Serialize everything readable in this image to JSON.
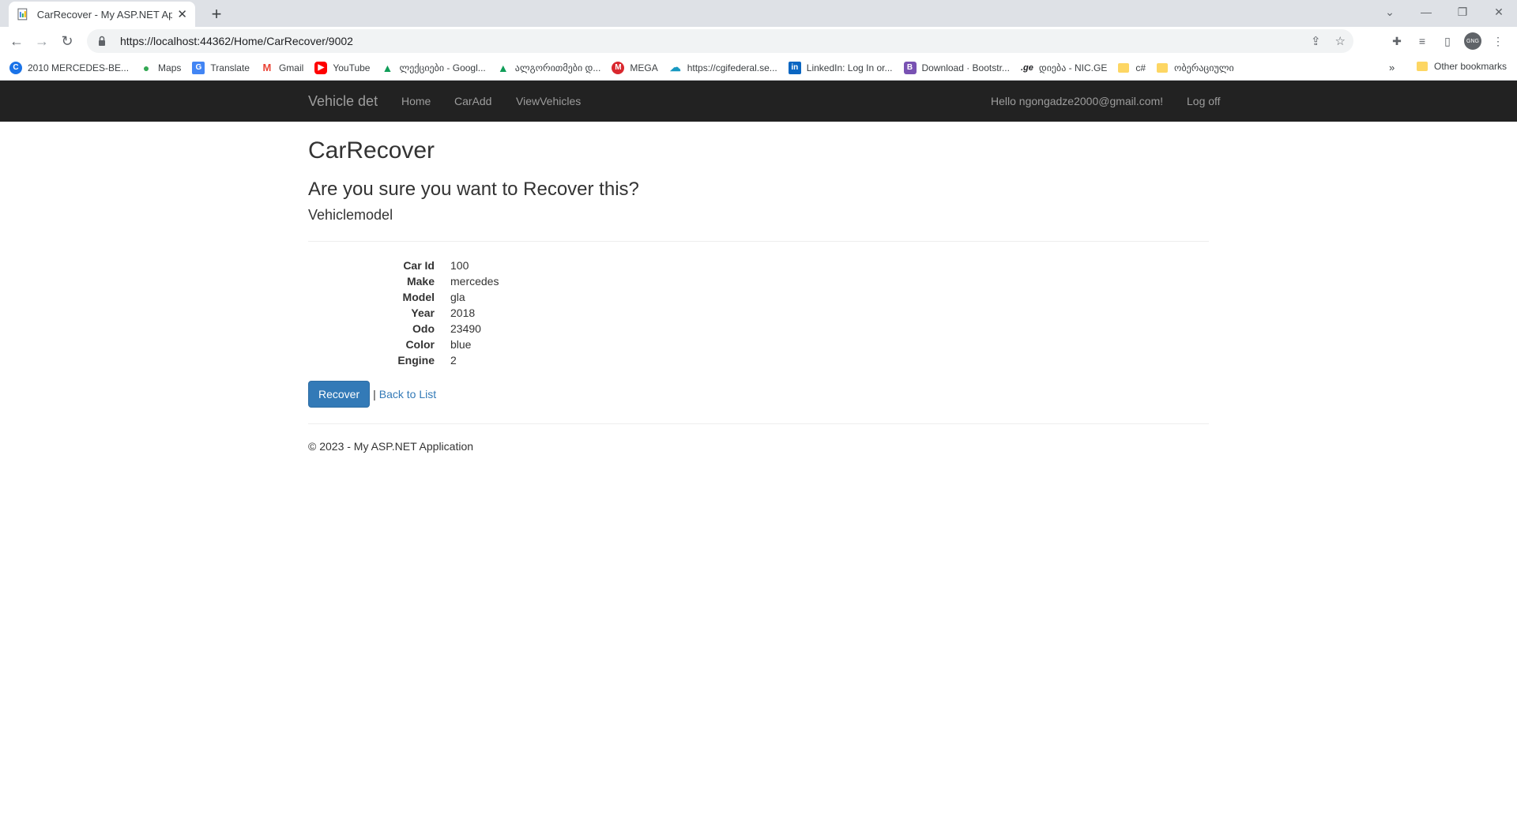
{
  "browser": {
    "tab_title": "CarRecover - My ASP.NET Applic",
    "tab_close": "✕",
    "new_tab": "+",
    "url": "https://localhost:44362/Home/CarRecover/9002",
    "profile_initials": "GNG",
    "bookmarks": [
      {
        "label": "2010 MERCEDES-BE...",
        "icon": "c-icon",
        "color": "#1a73e8"
      },
      {
        "label": "Maps",
        "icon": "maps-pin-icon",
        "color": "#34a853"
      },
      {
        "label": "Translate",
        "icon": "translate-icon",
        "color": "#4285f4"
      },
      {
        "label": "Gmail",
        "icon": "gmail-icon",
        "color": "#ea4335"
      },
      {
        "label": "YouTube",
        "icon": "youtube-icon",
        "color": "#ff0000"
      },
      {
        "label": "ლექციები - Googl...",
        "icon": "drive-icon",
        "color": "#fbbc04"
      },
      {
        "label": "ალგორითმები დ...",
        "icon": "drive-icon",
        "color": "#fbbc04"
      },
      {
        "label": "MEGA",
        "icon": "mega-icon",
        "color": "#d9272e"
      },
      {
        "label": "https://cgifederal.se...",
        "icon": "cloud-icon",
        "color": "#1798c1"
      },
      {
        "label": "LinkedIn: Log In or...",
        "icon": "linkedin-icon",
        "color": "#0a66c2"
      },
      {
        "label": "Download · Bootstr...",
        "icon": "bootstrap-icon",
        "color": "#7952b3"
      },
      {
        "label": "დიება - NIC.GE",
        "icon": "ge-icon",
        "color": "#202124"
      },
      {
        "label": "c#",
        "icon": "folder-icon",
        "color": "#fdd663"
      },
      {
        "label": "ობერაციული",
        "icon": "folder-icon",
        "color": "#fdd663"
      }
    ],
    "bookmarks_more": "»",
    "other_bookmarks": "Other bookmarks"
  },
  "navbar": {
    "brand": "Vehicle det",
    "links": [
      "Home",
      "CarAdd",
      "ViewVehicles"
    ],
    "greeting": "Hello ngongadze2000@gmail.com!",
    "logoff": "Log off"
  },
  "main": {
    "title": "CarRecover",
    "question": "Are you sure you want to Recover this?",
    "model_heading": "Vehiclemodel",
    "details": [
      {
        "label": "Car Id",
        "value": "100"
      },
      {
        "label": "Make",
        "value": "mercedes"
      },
      {
        "label": "Model",
        "value": "gla"
      },
      {
        "label": "Year",
        "value": "2018"
      },
      {
        "label": "Odo",
        "value": "23490"
      },
      {
        "label": "Color",
        "value": "blue"
      },
      {
        "label": "Engine",
        "value": "2"
      }
    ],
    "recover_button": "Recover",
    "separator": "|",
    "back_link": "Back to List"
  },
  "footer": {
    "text": "© 2023 - My ASP.NET Application"
  }
}
